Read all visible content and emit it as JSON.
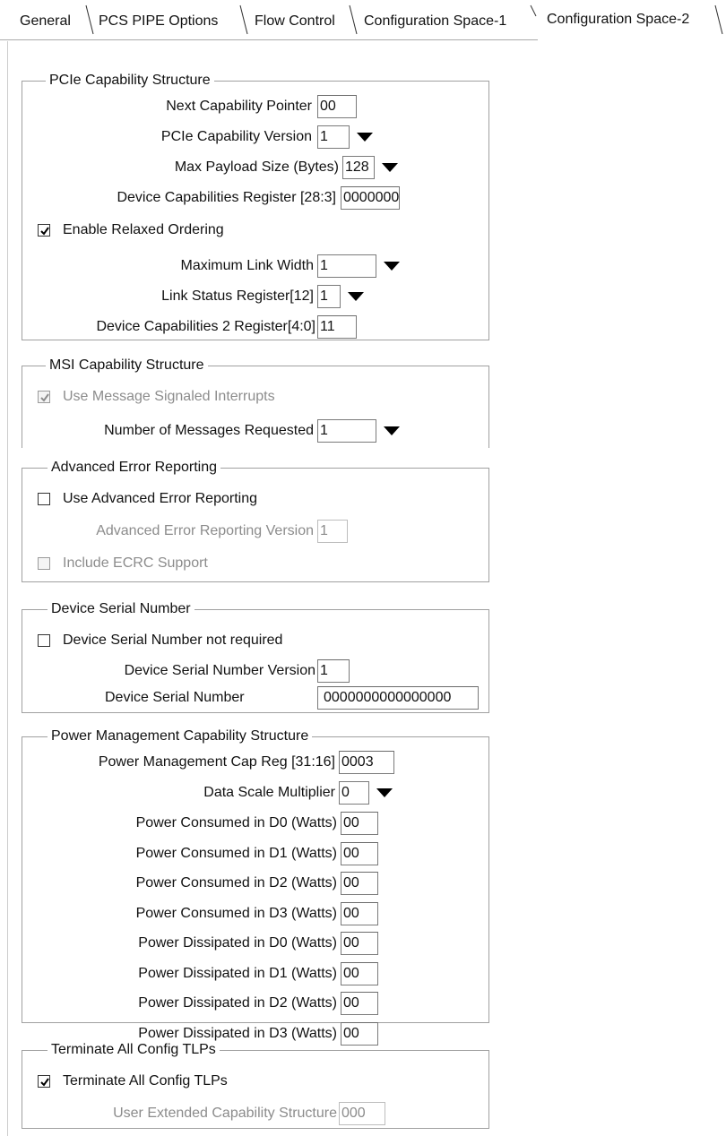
{
  "tabs": [
    {
      "label": "General"
    },
    {
      "label": "PCS PIPE Options"
    },
    {
      "label": "Flow Control"
    },
    {
      "label": "Configuration Space-1"
    },
    {
      "label": "Configuration Space-2"
    }
  ],
  "pcie": {
    "title": "PCIe Capability Structure",
    "next_cap_label": "Next Capability Pointer",
    "next_cap_value": "00",
    "version_label": "PCIe Capability Version",
    "version_value": "1",
    "payload_label": "Max Payload Size (Bytes)",
    "payload_value": "128",
    "devcap_label": "Device Capabilities Register [28:3]",
    "devcap_value": "0000000",
    "relaxed_label": "Enable Relaxed Ordering",
    "relaxed_checked": true,
    "link_width_label": "Maximum Link Width",
    "link_width_value": "1",
    "link_status_label": "Link Status Register[12]",
    "link_status_value": "1",
    "devcap2_label": "Device Capabilities 2 Register[4:0]",
    "devcap2_value": "11"
  },
  "msi": {
    "title": "MSI Capability Structure",
    "use_label": "Use Message Signaled Interrupts",
    "use_checked": true,
    "num_label": "Number of Messages Requested",
    "num_value": "1"
  },
  "aer": {
    "title": "Advanced Error Reporting",
    "use_label": "Use Advanced Error Reporting",
    "use_checked": false,
    "version_label": "Advanced Error Reporting Version",
    "version_value": "1",
    "ecrc_label": "Include ECRC Support",
    "ecrc_checked": false
  },
  "dsn": {
    "title": "Device Serial Number",
    "notreq_label": "Device Serial Number not required",
    "notreq_checked": false,
    "version_label": "Device Serial Number Version",
    "version_value": "1",
    "number_label": "Device Serial Number",
    "number_value": "0000000000000000"
  },
  "pm": {
    "title": "Power Management Capability Structure",
    "capreg_label": "Power Management Cap Reg [31:16]",
    "capreg_value": "0003",
    "scale_label": "Data Scale Multiplier",
    "scale_value": "0",
    "rows": [
      {
        "label": "Power Consumed in D0 (Watts)",
        "value": "00"
      },
      {
        "label": "Power Consumed in D1 (Watts)",
        "value": "00"
      },
      {
        "label": "Power Consumed in D2 (Watts)",
        "value": "00"
      },
      {
        "label": "Power Consumed in D3 (Watts)",
        "value": "00"
      },
      {
        "label": "Power Dissipated in D0 (Watts)",
        "value": "00"
      },
      {
        "label": "Power Dissipated in D1 (Watts)",
        "value": "00"
      },
      {
        "label": "Power Dissipated in D2 (Watts)",
        "value": "00"
      },
      {
        "label": "Power Dissipated in D3 (Watts)",
        "value": "00"
      }
    ]
  },
  "term": {
    "title": "Terminate All Config TLPs",
    "term_label": "Terminate All Config TLPs",
    "term_checked": true,
    "user_ext_label": "User Extended Capability Structure",
    "user_ext_value": "000"
  }
}
